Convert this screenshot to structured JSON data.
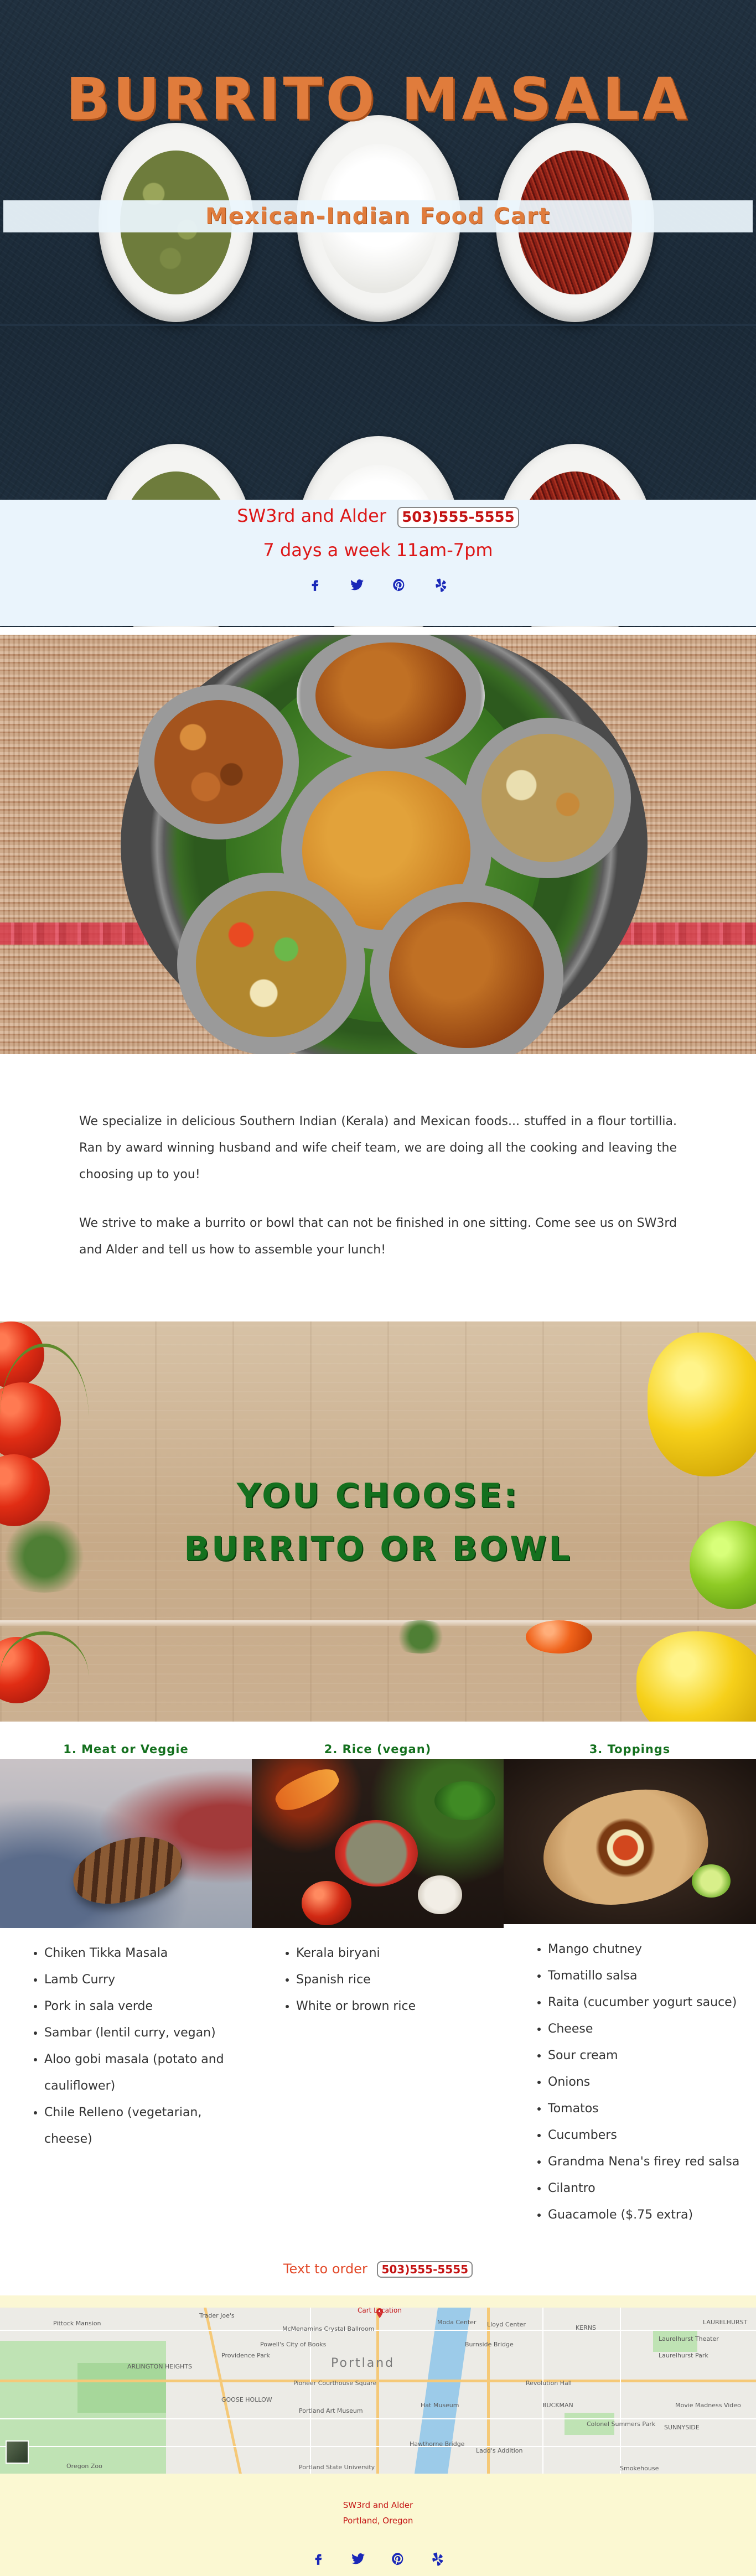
{
  "hero": {
    "title": "BURRITO MASALA",
    "banner": "Mexican-Indian Food Cart"
  },
  "info": {
    "location": "SW3rd and Alder",
    "phone": "503)555-5555",
    "hours": "7 days a week 11am-7pm",
    "socials": [
      "facebook-icon",
      "twitter-icon",
      "pinterest-icon",
      "yelp-icon"
    ]
  },
  "about": {
    "paragraphs": [
      "We specialize in delicious Southern Indian (Kerala) and Mexican foods... stuffed in a flour tortillia.   Ran by award winning husband and wife cheif team, we are doing all the cooking and leaving the choosing up to you!",
      "We strive to make a burrito or bowl that can not be finished in one sitting.   Come see us on SW3rd and Alder and tell us how to assemble your lunch!"
    ]
  },
  "choose": {
    "line1": "YOU   CHOOSE:",
    "line2": "BURRITO OR BOWL"
  },
  "columns": [
    {
      "heading": "1. Meat or Veggie",
      "items": [
        "Chiken Tikka Masala",
        "Lamb Curry",
        "Pork in sala verde",
        "Sambar (lentil curry, vegan)",
        "Aloo gobi masala (potato and cauliflower)",
        "Chile Relleno (vegetarian, cheese)"
      ]
    },
    {
      "heading": "2. Rice (vegan)",
      "items": [
        "Kerala biryani",
        "Spanish rice",
        "White or brown rice"
      ]
    },
    {
      "heading": "3. Toppings",
      "items": [
        "Mango chutney",
        "Tomatillo salsa",
        "Raita (cucumber yogurt sauce)",
        "Cheese",
        "Sour cream",
        "Onions",
        "Tomatos",
        "Cucumbers",
        "Grandma Nena's firey red salsa",
        "Cilantro",
        "Guacamole ($.75 extra)"
      ]
    }
  ],
  "order": {
    "label": "Text to order",
    "phone": "503)555-5555"
  },
  "map": {
    "pin_label": "Cart Location",
    "city": "Portland",
    "labels": [
      "Pittock Mansion",
      "Trader Joe's",
      "McMenamins Crystal Ballroom",
      "Providence Park",
      "Powell's City of Books",
      "ARLINGTON HEIGHTS",
      "Pioneer Courthouse Square",
      "Portland Art Museum",
      "GOOSE HOLLOW",
      "Portland State University",
      "Oregon Zoo",
      "Burnside Bridge",
      "Lloyd Center",
      "Laurelhurst Theater",
      "Laurelhurst Park",
      "KERNS",
      "Revolution Hall",
      "BUCKMAN",
      "SUNNYSIDE",
      "Movie Madness Video",
      "Colonel Summers Park",
      "Hawthorne Bridge",
      "Ladd's Addition",
      "Smokehouse",
      "Moda Center",
      "LAURELHURST",
      "Hat Museum"
    ]
  },
  "footer": {
    "line1": "SW3rd and Alder",
    "line2": "Portland, Oregon"
  },
  "colors": {
    "orange": "#e07c3c",
    "red": "#dd1818",
    "green": "#14701e",
    "blue": "#1a28b8",
    "footer_bg": "#fbf8d2",
    "info_bg": "#eaf4fc"
  }
}
